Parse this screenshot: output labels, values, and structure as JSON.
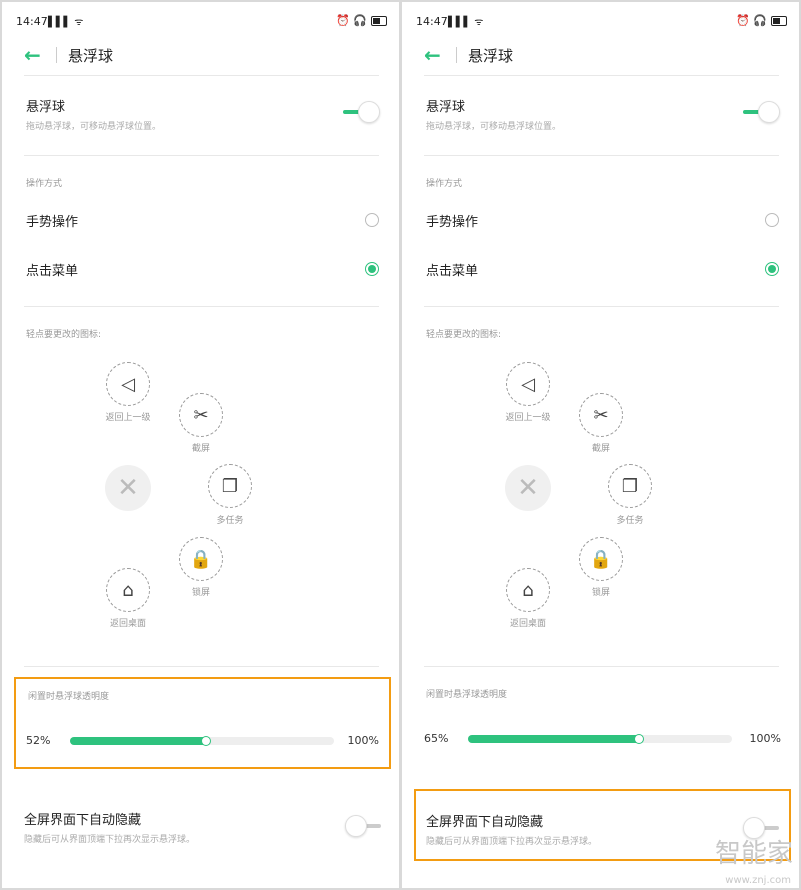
{
  "panels": [
    {
      "status": {
        "time": "14:47",
        "signal": "▌▌▌ ᯤ",
        "icons": "⏰ 🎧"
      },
      "header": {
        "title": "悬浮球"
      },
      "float_ball": {
        "title": "悬浮球",
        "subtitle": "拖动悬浮球，可移动悬浮球位置。",
        "enabled": true
      },
      "mode": {
        "label": "操作方式",
        "options": [
          {
            "label": "手势操作",
            "selected": false
          },
          {
            "label": "点击菜单",
            "selected": true
          }
        ]
      },
      "icons_section": {
        "label": "轻点要更改的图标:",
        "buttons": [
          {
            "label": "返回上一级",
            "icon": "back-triangle-icon",
            "glyph": "◁"
          },
          {
            "label": "截屏",
            "icon": "screenshot-icon",
            "glyph": "✂"
          },
          {
            "label": "多任务",
            "icon": "multitask-icon",
            "glyph": "❐"
          },
          {
            "label": "锁屏",
            "icon": "lock-icon",
            "glyph": "🔒"
          },
          {
            "label": "返回桌面",
            "icon": "home-icon",
            "glyph": "⌂"
          }
        ],
        "close_glyph": "✕"
      },
      "opacity": {
        "label": "闲置时悬浮球透明度",
        "value_label": "52%",
        "value": 0.52,
        "max_label": "100%",
        "highlighted": true
      },
      "auto_hide": {
        "title": "全屏界面下自动隐藏",
        "subtitle": "隐藏后可从界面顶端下拉再次显示悬浮球。",
        "enabled": false,
        "highlighted": false
      }
    },
    {
      "status": {
        "time": "14:47",
        "signal": "▌▌▌ ᯤ",
        "icons": "⏰ 🎧"
      },
      "header": {
        "title": "悬浮球"
      },
      "float_ball": {
        "title": "悬浮球",
        "subtitle": "拖动悬浮球，可移动悬浮球位置。",
        "enabled": true
      },
      "mode": {
        "label": "操作方式",
        "options": [
          {
            "label": "手势操作",
            "selected": false
          },
          {
            "label": "点击菜单",
            "selected": true
          }
        ]
      },
      "icons_section": {
        "label": "轻点要更改的图标:",
        "buttons": [
          {
            "label": "返回上一级",
            "icon": "back-triangle-icon",
            "glyph": "◁"
          },
          {
            "label": "截屏",
            "icon": "screenshot-icon",
            "glyph": "✂"
          },
          {
            "label": "多任务",
            "icon": "multitask-icon",
            "glyph": "❐"
          },
          {
            "label": "锁屏",
            "icon": "lock-icon",
            "glyph": "🔒"
          },
          {
            "label": "返回桌面",
            "icon": "home-icon",
            "glyph": "⌂"
          }
        ],
        "close_glyph": "✕"
      },
      "opacity": {
        "label": "闲置时悬浮球透明度",
        "value_label": "65%",
        "value": 0.65,
        "max_label": "100%",
        "highlighted": false
      },
      "auto_hide": {
        "title": "全屏界面下自动隐藏",
        "subtitle": "隐藏后可从界面顶端下拉再次显示悬浮球。",
        "enabled": false,
        "highlighted": true
      }
    }
  ],
  "watermark": {
    "brand": "智能家",
    "url": "www.znj.com"
  },
  "colors": {
    "accent": "#2ec27e",
    "highlight": "#f39c12"
  }
}
